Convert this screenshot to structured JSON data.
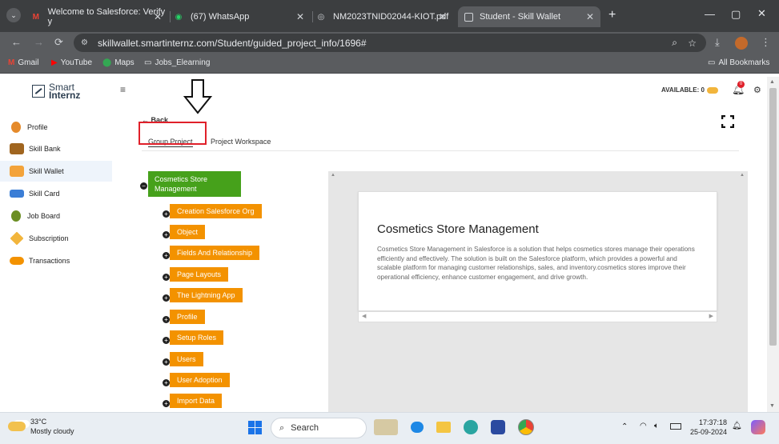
{
  "browser": {
    "tabs": [
      {
        "title": "Welcome to Salesforce: Verify y",
        "icon": "gmail-icon"
      },
      {
        "title": "(67) WhatsApp",
        "icon": "whatsapp-icon"
      },
      {
        "title": "NM2023TNID02044-KIOT.pdf",
        "icon": "globe-icon"
      },
      {
        "title": "Student - Skill Wallet",
        "icon": "page-icon"
      }
    ],
    "url": "skillwallet.smartinternz.com/Student/guided_project_info/1696#",
    "bookmarks": [
      "Gmail",
      "YouTube",
      "Maps",
      "Jobs_Elearning"
    ],
    "all_bookmarks": "All Bookmarks"
  },
  "app": {
    "logo_line1": "Smart",
    "logo_line2": "Internz",
    "available_label": "AVAILABLE: 0",
    "notification_count": "0"
  },
  "sidebar": {
    "items": [
      {
        "label": "Profile",
        "color": "#e58a2a"
      },
      {
        "label": "Skill Bank",
        "color": "#a0651f"
      },
      {
        "label": "Skill Wallet",
        "color": "#f3a33a"
      },
      {
        "label": "Skill Card",
        "color": "#3b7ed6"
      },
      {
        "label": "Job Board",
        "color": "#6b8e23"
      },
      {
        "label": "Subscription",
        "color": "#f2b53c"
      },
      {
        "label": "Transactions",
        "color": "#f39200"
      }
    ]
  },
  "main": {
    "back_label": "Back",
    "tabs": [
      "Group Project",
      "Project Workspace"
    ],
    "tree": {
      "root": "Cosmetics Store Management",
      "children": [
        "Creation Salesforce Org",
        "Object",
        "Fields And Relationship",
        "Page Layouts",
        "The Lightning App",
        "Profile",
        "Setup Roles",
        "Users",
        "User Adoption",
        "Import Data"
      ]
    },
    "card": {
      "title": "Cosmetics Store Management",
      "body": "Cosmetics Store Management in Salesforce is a solution that helps cosmetics stores manage their operations efficiently and effectively. The solution is built on the Salesforce platform, which provides a powerful and scalable platform for managing customer relationships, sales, and inventory.cosmetics stores improve their operational efficiency, enhance customer engagement, and drive growth."
    }
  },
  "taskbar": {
    "temp": "33°C",
    "weather": "Mostly cloudy",
    "search": "Search",
    "time": "17:37:18",
    "date": "25-09-2024"
  },
  "colors": {
    "accent_green": "#46a11b",
    "accent_orange": "#f39200",
    "highlight_red": "#e0202a"
  }
}
